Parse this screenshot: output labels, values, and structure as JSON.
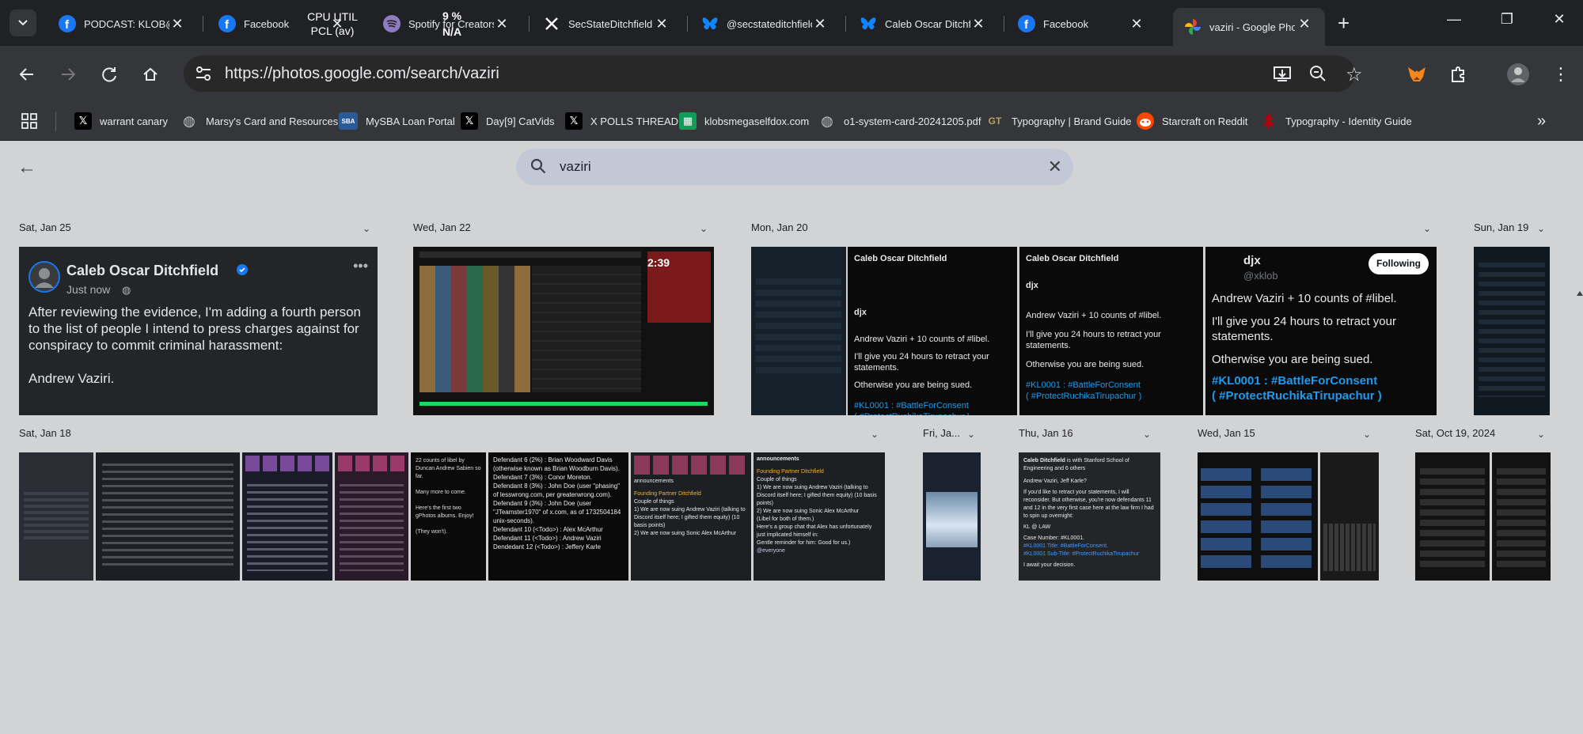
{
  "tabs": [
    {
      "title": "PODCAST: KLOB@"
    },
    {
      "title": "Facebook"
    },
    {
      "title": "Spotify for Creators"
    },
    {
      "title": "SecStateDitchfield"
    },
    {
      "title": "@secstateditchfield"
    },
    {
      "title": "Caleb Oscar Ditchfield"
    },
    {
      "title": "Facebook"
    },
    {
      "title": "vaziri - Google Photos"
    }
  ],
  "cpu_overlay": {
    "line1": "CPU UTIL",
    "line2": "PCL (av)",
    "pct": "9 %",
    "na": "N/A"
  },
  "address": {
    "url": "https://photos.google.com/search/vaziri"
  },
  "bookmarks": [
    {
      "label": "warrant canary"
    },
    {
      "label": "Marsy's Card and Resources"
    },
    {
      "label": "MySBA Loan Portal",
      "icon": "SBA"
    },
    {
      "label": "Day[9] CatVids"
    },
    {
      "label": "X POLLS THREAD"
    },
    {
      "label": "klobsmegaselfdox.com"
    },
    {
      "label": "o1-system-card-20241205.pdf"
    },
    {
      "label": "Typography | Brand Guide",
      "icon": "GT"
    },
    {
      "label": "Starcraft on Reddit"
    },
    {
      "label": "Typography - Identity Guide"
    }
  ],
  "search": {
    "query": "vaziri"
  },
  "groups": [
    {
      "date": "Sat, Jan 25"
    },
    {
      "date": "Wed, Jan 22"
    },
    {
      "date": "Mon, Jan 20"
    },
    {
      "date": "Sun, Jan 19"
    },
    {
      "date": "Sat, Jan 18"
    },
    {
      "date": "Fri, Ja..."
    },
    {
      "date": "Thu, Jan 16"
    },
    {
      "date": "Wed, Jan 15"
    },
    {
      "date": "Sat, Oct 19, 2024"
    }
  ],
  "post": {
    "name": "Caleb Oscar Ditchfield",
    "time": "Just now",
    "body": "After reviewing the evidence, I'm adding a fourth person to the list of people I intend to press charges against for conspiracy to commit criminal harassment:",
    "body2": "Andrew Vaziri."
  },
  "tweet": {
    "user": "djx",
    "handle": "@xklob",
    "follow": "Following",
    "l1": "Andrew Vaziri + 10 counts of #libel.",
    "l2": "I'll give you 24 hours to retract your statements.",
    "l3": "Otherwise you are being sued.",
    "l4": "#KL0001 : #BattleForConsent",
    "l5": "( #ProtectRuchikaTirupachur )"
  },
  "thumb_time": "2:39",
  "defendants": [
    "Defendant 6 (2%) : Brian Woodward Davis (otherwise known as Brian Woodburn Davis).",
    "Defendant 7 (3%) : Conor Moreton.",
    "Defendant 8 (3%) : John Doe (user \"phasing\" of lesswrong.com, per greaterwrong.com).",
    "Defendant 9 (3%) : John Doe (user \"JTeamster1970\" of x.com, as of 1732504184 unix-seconds).",
    "Defendant 10 (<Todo>) : Alex McArthur",
    "Defendant 11 (<Todo>) : Andrew Vaziri",
    "Dendedant 12 (<Todo>) : Jeffery Karle"
  ],
  "announce": {
    "channel": "announcements",
    "title": "Founding Partner Ditchfield",
    "sub": "Couple of things",
    "t1": "1) We are now suing Andrew Vaziri (talking to Discord itself here; I gifted them equity) (10 basis points)",
    "t2": "2) We are now suing Sonic Alex McArthur",
    "t3": "(Libel for both of them.)",
    "t4": "Here's a group chat that Alex has unfortunately just implicated himself in:",
    "t5": "Gentle reminder for him: Good for us.)",
    "t6": "@everyone"
  },
  "thu": {
    "name": "Caleb Ditchfield",
    "with": "is with Stanford School of Engineering and 6 others",
    "l1": "Andrew Vaziri, Jeff Karle?",
    "l2": "If you'd like to retract your statements, I will reconsider. But otherwise, you're now defendants 11 and 12 in the very first case here at the law firm I had to spin up overnight:",
    "l3": "KL @ LAW",
    "l4": "Case Number: #KL0001.",
    "l5": "#KL0001 Title: #BattleForConsent.",
    "l6": "#KL0001 Sub-Title: #ProtectRuchikaTirupachur",
    "l7": "I await your decision."
  },
  "scam": {
    "l1": "22 counts of libel by Duncan Andrew Sabien so far.",
    "l2": "Many more to come.",
    "l3": "Here's the first two gPhotos albums. Enjoy!",
    "l4": "(They won't)."
  },
  "colors": {
    "chrome_bg": "#202124",
    "toolbar_bg": "#35363a",
    "content_bg": "#d2d3d5",
    "search_bg": "#c2c8d6",
    "link_blue": "#1d9bf0",
    "spotify_green": "#1ed760"
  }
}
